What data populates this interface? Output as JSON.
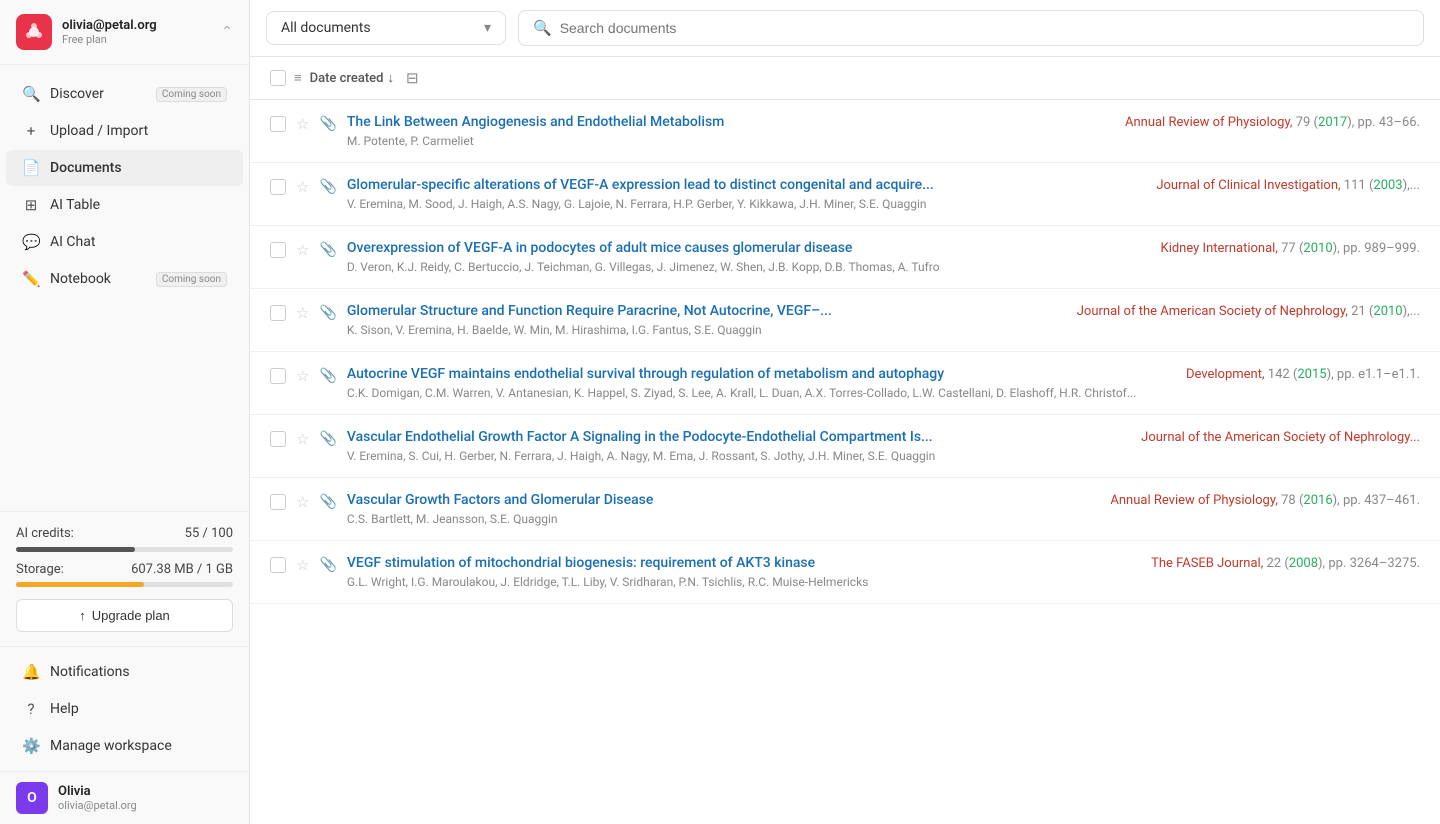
{
  "sidebar": {
    "user": {
      "email": "olivia@petal.org",
      "plan": "Free plan",
      "name": "Olivia",
      "avatar_letter": "O"
    },
    "nav_items": [
      {
        "id": "discover",
        "label": "Discover",
        "icon": "🔍",
        "badge": "Coming soon",
        "active": false
      },
      {
        "id": "upload",
        "label": "Upload / Import",
        "icon": "+",
        "badge": null,
        "active": false
      },
      {
        "id": "documents",
        "label": "Documents",
        "icon": "📄",
        "badge": null,
        "active": true
      },
      {
        "id": "ai-table",
        "label": "AI Table",
        "icon": "⊞",
        "badge": null,
        "active": false
      },
      {
        "id": "ai-chat",
        "label": "AI Chat",
        "icon": "💬",
        "badge": null,
        "active": false
      },
      {
        "id": "notebook",
        "label": "Notebook",
        "icon": "✏️",
        "badge": "Coming soon",
        "active": false
      }
    ],
    "credits": {
      "label": "AI credits:",
      "used": 55,
      "total": 100,
      "display": "55 / 100"
    },
    "storage": {
      "label": "Storage:",
      "used": "607.38 MB",
      "total": "1 GB",
      "display": "607.38 MB / 1 GB",
      "percent": 59
    },
    "upgrade_label": "Upgrade plan",
    "bottom_items": [
      {
        "id": "notifications",
        "label": "Notifications",
        "icon": "🔔"
      },
      {
        "id": "help",
        "label": "Help",
        "icon": "?"
      },
      {
        "id": "manage-workspace",
        "label": "Manage workspace",
        "icon": "⚙️"
      }
    ]
  },
  "topbar": {
    "doc_filter": "All documents",
    "search_placeholder": "Search documents"
  },
  "doc_list": {
    "sort_label": "Date created",
    "documents": [
      {
        "id": 1,
        "title": "The Link Between Angiogenesis and Endothelial Metabolism",
        "journal": "Annual Review of Physiology",
        "year": "2017",
        "volume_pages": "79 (2017), pp. 43–66.",
        "authors": "M. Potente, P. Carmeliet",
        "has_attachment": true
      },
      {
        "id": 2,
        "title": "Glomerular-specific alterations of VEGF-A expression lead to distinct congenital and acquire...",
        "journal": "Journal of Clinical Investigation",
        "year": "2003",
        "volume_pages": "111 (2003),...",
        "authors": "V. Eremina, M. Sood, J. Haigh, A.S. Nagy, G. Lajoie, N. Ferrara, H.P. Gerber, Y. Kikkawa, J.H. Miner, S.E. Quaggin",
        "has_attachment": true
      },
      {
        "id": 3,
        "title": "Overexpression of VEGF-A in podocytes of adult mice causes glomerular disease",
        "journal": "Kidney International",
        "year": "2010",
        "volume_pages": "77 (2010), pp. 989–999.",
        "authors": "D. Veron, K.J. Reidy, C. Bertuccio, J. Teichman, G. Villegas, J. Jimenez, W. Shen, J.B. Kopp, D.B. Thomas, A. Tufro",
        "has_attachment": true
      },
      {
        "id": 4,
        "title": "Glomerular Structure and Function Require Paracrine, Not Autocrine, VEGF–...",
        "journal": "Journal of the American Society of Nephrology",
        "year": "2010",
        "volume_pages": "21 (2010),...",
        "authors": "K. Sison, V. Eremina, H. Baelde, W. Min, M. Hirashima, I.G. Fantus, S.E. Quaggin",
        "has_attachment": true
      },
      {
        "id": 5,
        "title": "Autocrine VEGF maintains endothelial survival through regulation of metabolism and autophagy",
        "journal": "Development",
        "year": "2015",
        "volume_pages": "142 (2015), pp. e1.1–e1.1.",
        "authors": "C.K. Domigan, C.M. Warren, V. Antanesian, K. Happel, S. Ziyad, S. Lee, A. Krall, L. Duan, A.X. Torres-Collado, L.W. Castellani, D. Elashoff, H.R. Christof...",
        "has_attachment": true
      },
      {
        "id": 6,
        "title": "Vascular Endothelial Growth Factor A Signaling in the Podocyte-Endothelial Compartment Is...",
        "journal": "Journal of the American Society of Nephrology...",
        "year": null,
        "volume_pages": null,
        "authors": "V. Eremina, S. Cui, H. Gerber, N. Ferrara, J. Haigh, A. Nagy, M. Ema, J. Rossant, S. Jothy, J.H. Miner, S.E. Quaggin",
        "has_attachment": true
      },
      {
        "id": 7,
        "title": "Vascular Growth Factors and Glomerular Disease",
        "journal": "Annual Review of Physiology",
        "year": "2016",
        "volume_pages": "78 (2016), pp. 437–461.",
        "authors": "C.S. Bartlett, M. Jeansson, S.E. Quaggin",
        "has_attachment": true
      },
      {
        "id": 8,
        "title": "VEGF stimulation of mitochondrial biogenesis: requirement of AKT3 kinase",
        "journal": "The FASEB Journal",
        "year": "2008",
        "volume_pages": "22 (2008), pp. 3264–3275.",
        "authors": "G.L. Wright, I.G. Maroulakou, J. Eldridge, T.L. Liby, V. Sridharan, P.N. Tsichlis, R.C. Muise-Helmericks",
        "has_attachment": true
      }
    ]
  }
}
